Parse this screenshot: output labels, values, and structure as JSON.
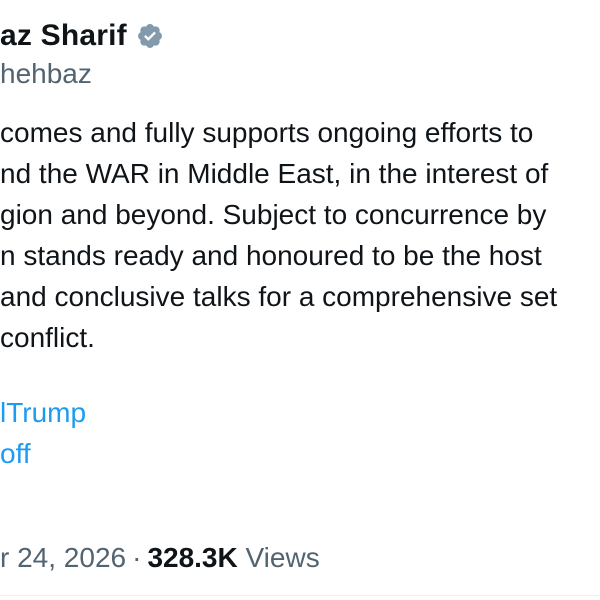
{
  "author": {
    "display_name": "az Sharif",
    "handle": "hehbaz",
    "verified_badge_color": "#829aab",
    "verified_icon": "verified-badge-icon"
  },
  "tweet": {
    "lines": [
      "comes and fully supports ongoing efforts to",
      "nd the WAR in Middle East, in the interest of",
      "gion and beyond. Subject to concurrence by",
      "n stands ready and honoured to be the host",
      "and conclusive talks for a comprehensive set",
      "conflict."
    ],
    "mentions": [
      "lTrump",
      "off"
    ],
    "link_color": "#1d9bf0"
  },
  "meta": {
    "date": "r 24, 2026",
    "separator": "·",
    "views_count": "328.3K",
    "views_label": "Views"
  }
}
